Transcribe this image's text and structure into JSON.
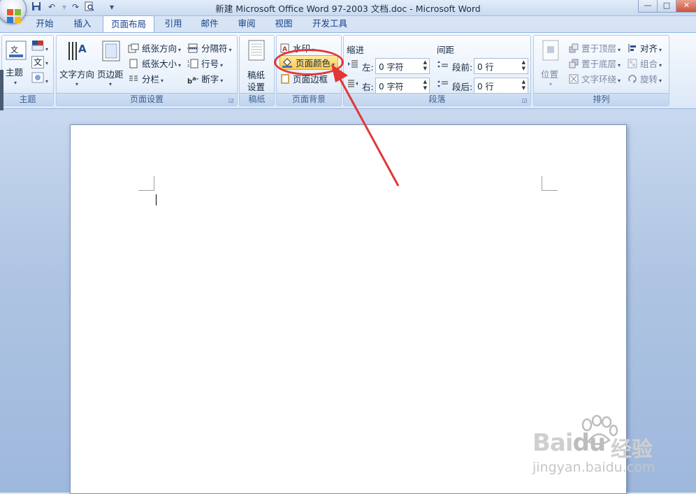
{
  "window": {
    "title": "新建 Microsoft Office Word 97-2003 文档.doc - Microsoft Word",
    "buttons": {
      "minimize": "—",
      "maximize": "□",
      "close": "✕"
    }
  },
  "quick_access": [
    {
      "name": "save-icon",
      "glyph": "💾"
    },
    {
      "name": "undo-icon",
      "glyph": "↶"
    },
    {
      "name": "redo-icon",
      "glyph": "↷"
    },
    {
      "name": "print-preview-icon",
      "glyph": "🔍"
    },
    {
      "name": "customize-qat-icon",
      "glyph": "▾"
    }
  ],
  "tabs": [
    {
      "label": "开始",
      "active": false
    },
    {
      "label": "插入",
      "active": false
    },
    {
      "label": "页面布局",
      "active": true
    },
    {
      "label": "引用",
      "active": false
    },
    {
      "label": "邮件",
      "active": false
    },
    {
      "label": "审阅",
      "active": false
    },
    {
      "label": "视图",
      "active": false
    },
    {
      "label": "开发工具",
      "active": false
    }
  ],
  "ribbon": {
    "theme": {
      "group_label": "主题",
      "themes_button": "主题"
    },
    "page_setup": {
      "group_label": "页面设置",
      "text_direction": "文字方向",
      "margins": "页边距",
      "orientation": "纸张方向",
      "size": "纸张大小",
      "columns": "分栏",
      "breaks": "分隔符",
      "line_numbers": "行号",
      "hyphenation": "断字"
    },
    "draft_paper": {
      "group_label": "稿纸",
      "button_line1": "稿纸",
      "button_line2": "设置"
    },
    "page_background": {
      "group_label": "页面背景",
      "watermark": "水印",
      "page_color": "页面颜色",
      "page_borders": "页面边框"
    },
    "paragraph": {
      "group_label": "段落",
      "indent_title": "缩进",
      "indent_left_label": "左:",
      "indent_left_value": "0 字符",
      "indent_right_label": "右:",
      "indent_right_value": "0 字符",
      "spacing_title": "间距",
      "spacing_before_label": "段前:",
      "spacing_before_value": "0 行",
      "spacing_after_label": "段后:",
      "spacing_after_value": "0 行"
    },
    "arrange": {
      "group_label": "排列",
      "position": "位置",
      "bring_to_front": "置于顶层",
      "send_to_back": "置于底层",
      "text_wrapping": "文字环绕",
      "align": "对齐",
      "group": "组合",
      "rotate": "旋转"
    }
  },
  "watermark_logo": {
    "brand": "Bai",
    "brand_suffix": "du",
    "cn": "经验",
    "url": "jingyan.baidu.com"
  },
  "colors": {
    "annotation": "#e23636",
    "accent": "#15428b",
    "page_color_highlight": "#ffd86a"
  }
}
